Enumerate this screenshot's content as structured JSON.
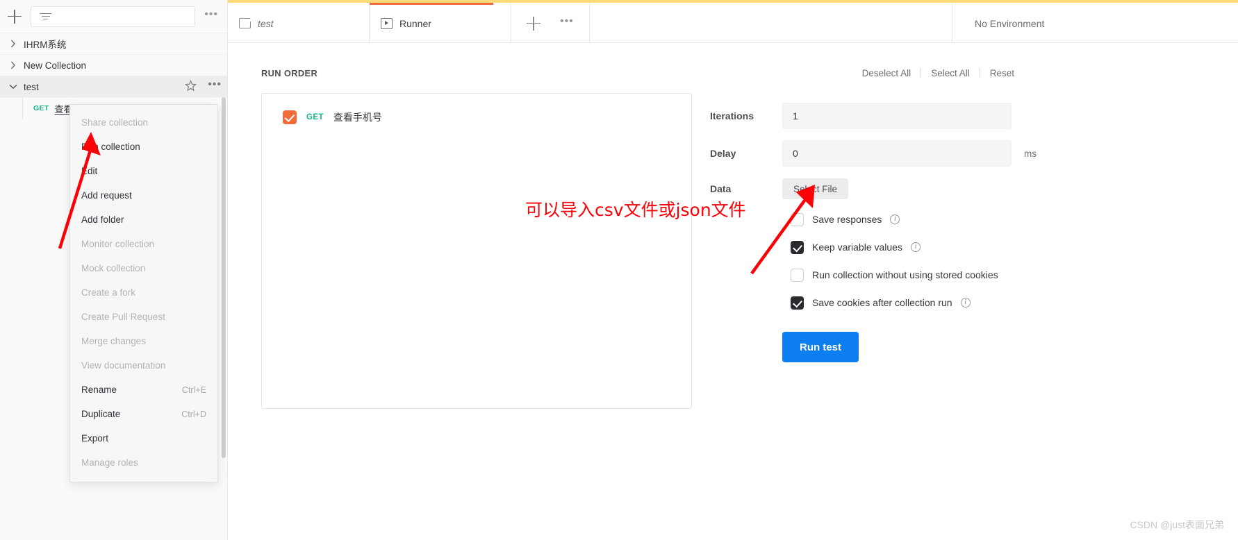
{
  "sidebar": {
    "filter_placeholder": "",
    "add_label": "+",
    "more_label": "•••",
    "collections": [
      {
        "name": "IHRM系统",
        "expanded": false,
        "active": false
      },
      {
        "name": "New Collection",
        "expanded": false,
        "active": false
      },
      {
        "name": "test",
        "expanded": true,
        "active": true
      }
    ],
    "request": {
      "method": "GET",
      "name": "查看手机号"
    }
  },
  "context_menu": {
    "items": [
      {
        "label": "Share collection",
        "shortcut": "",
        "disabled": true
      },
      {
        "label": "Run collection",
        "shortcut": "",
        "disabled": false
      },
      {
        "label": "Edit",
        "shortcut": "",
        "disabled": false
      },
      {
        "label": "Add request",
        "shortcut": "",
        "disabled": false
      },
      {
        "label": "Add folder",
        "shortcut": "",
        "disabled": false
      },
      {
        "label": "Monitor collection",
        "shortcut": "",
        "disabled": true
      },
      {
        "label": "Mock collection",
        "shortcut": "",
        "disabled": true
      },
      {
        "label": "Create a fork",
        "shortcut": "",
        "disabled": true
      },
      {
        "label": "Create Pull Request",
        "shortcut": "",
        "disabled": true
      },
      {
        "label": "Merge changes",
        "shortcut": "",
        "disabled": true
      },
      {
        "label": "View documentation",
        "shortcut": "",
        "disabled": true
      },
      {
        "label": "Rename",
        "shortcut": "Ctrl+E",
        "disabled": false
      },
      {
        "label": "Duplicate",
        "shortcut": "Ctrl+D",
        "disabled": false
      },
      {
        "label": "Export",
        "shortcut": "",
        "disabled": false
      },
      {
        "label": "Manage roles",
        "shortcut": "",
        "disabled": true
      }
    ]
  },
  "tabs": {
    "items": [
      {
        "label": "test",
        "icon": "folder-icon",
        "accent": "#fcda7a",
        "active": false
      },
      {
        "label": "Runner",
        "icon": "play-icon",
        "accent": "#f26b3a",
        "active": true
      }
    ],
    "new_tab_label": "+",
    "more_label": "•••",
    "environment": "No Environment"
  },
  "runner": {
    "run_order_title": "RUN ORDER",
    "actions": {
      "deselect_all": "Deselect All",
      "select_all": "Select All",
      "reset": "Reset"
    },
    "requests": [
      {
        "checked": true,
        "method": "GET",
        "name": "查看手机号"
      }
    ],
    "settings": {
      "iterations_label": "Iterations",
      "iterations_value": "1",
      "delay_label": "Delay",
      "delay_value": "0",
      "delay_unit": "ms",
      "data_label": "Data",
      "select_file_label": "Select File"
    },
    "options": [
      {
        "label": "Save responses",
        "checked": false,
        "info": true
      },
      {
        "label": "Keep variable values",
        "checked": true,
        "info": true
      },
      {
        "label": "Run collection without using stored cookies",
        "checked": false,
        "info": false
      },
      {
        "label": "Save cookies after collection run",
        "checked": true,
        "info": true
      }
    ],
    "run_button": "Run test"
  },
  "annotations": {
    "note": "可以导入csv文件或json文件",
    "color": "#fb0007"
  },
  "watermark": "CSDN @just表面兄弟"
}
